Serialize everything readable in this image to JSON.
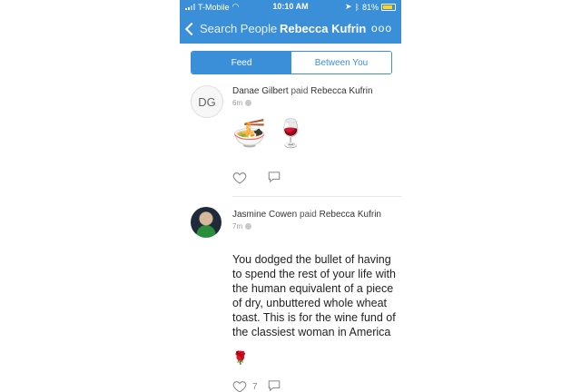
{
  "status_bar": {
    "carrier": "T-Mobile",
    "time": "10:10 AM",
    "battery": "81%"
  },
  "nav": {
    "back_label": "Search People",
    "title": "Rebecca Kufrin",
    "more": "ooo"
  },
  "tabs": [
    {
      "label": "Feed",
      "active": true
    },
    {
      "label": "Between You",
      "active": false
    }
  ],
  "feed": [
    {
      "avatar_initials": "DG",
      "payer": "Danae Gilbert",
      "verb": "paid",
      "payee": "Rebecca Kufrin",
      "time": "6m",
      "emojis": "🍜 🍷",
      "message": ""
    },
    {
      "payer": "Jasmine Cowen",
      "verb": "paid",
      "payee": "Rebecca Kufrin",
      "time": "7m",
      "message": "You dodged the bullet of having to spend the rest of your life with the human equivalent of a piece of dry, unbuttered whole wheat toast. This is for the wine fund of the classiest woman in America",
      "trailing_emoji": "🌹",
      "like_count": "7"
    }
  ]
}
